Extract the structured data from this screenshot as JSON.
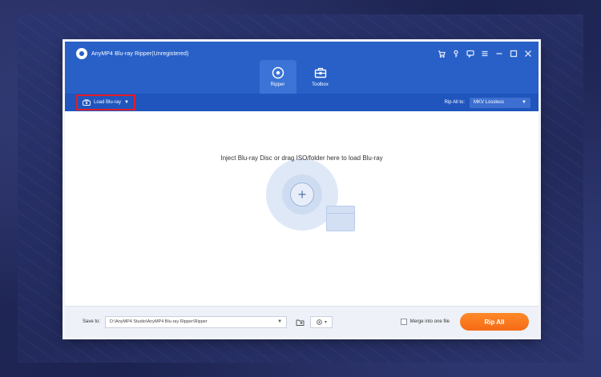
{
  "app": {
    "title": "AnyMP4 Blu-ray Ripper(Unregistered)"
  },
  "tabs": [
    {
      "label": "Ripper",
      "icon": "disc-icon",
      "active": true
    },
    {
      "label": "Toolbox",
      "icon": "toolbox-icon",
      "active": false
    }
  ],
  "toolbar": {
    "load_label": "Load Blu-ray",
    "rip_all_to_label": "Rip All to:",
    "format_value": "MKV Lossless"
  },
  "main": {
    "hint": "Inject Blu-ray Disc or drag ISO/folder here to load Blu-ray"
  },
  "footer": {
    "save_to_label": "Save to:",
    "save_path": "D:\\AnyMP4 Studio\\AnyMP4 Blu-ray Ripper\\Ripper",
    "merge_label": "Merge into one file",
    "merge_checked": false,
    "rip_all_label": "Rip All"
  },
  "colors": {
    "header_blue": "#2860c8",
    "toolbar_blue": "#1f55bd",
    "accent_orange": "#f56a15",
    "highlight_red": "#e11d2a"
  }
}
